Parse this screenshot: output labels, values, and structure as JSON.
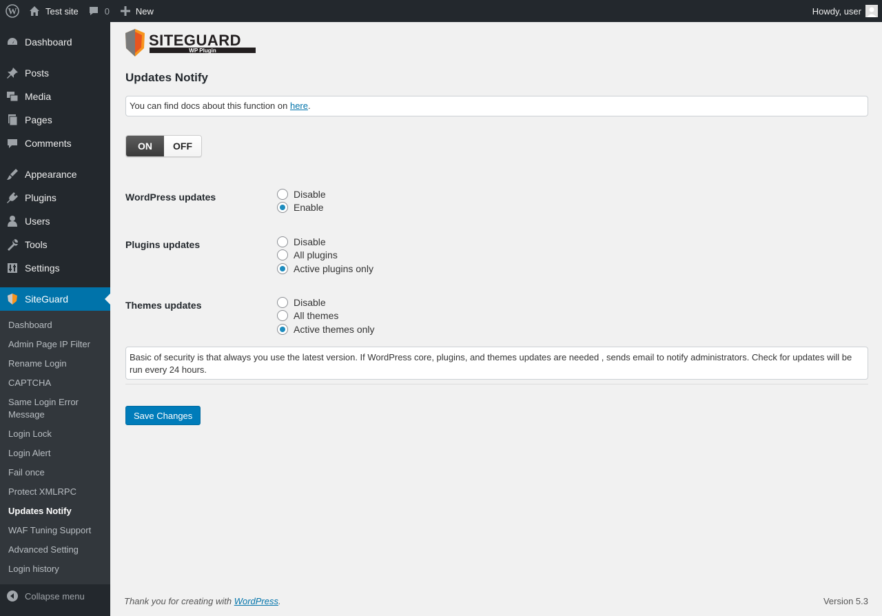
{
  "adminbar": {
    "site_name": "Test site",
    "comment_count": "0",
    "new_label": "New",
    "greeting": "Howdy, user"
  },
  "menu": {
    "items": [
      {
        "label": "Dashboard",
        "icon": "dashboard-icon"
      },
      {
        "label": "Posts",
        "icon": "pin-icon"
      },
      {
        "label": "Media",
        "icon": "media-icon"
      },
      {
        "label": "Pages",
        "icon": "pages-icon"
      },
      {
        "label": "Comments",
        "icon": "comment-icon"
      },
      {
        "label": "Appearance",
        "icon": "brush-icon"
      },
      {
        "label": "Plugins",
        "icon": "plug-icon"
      },
      {
        "label": "Users",
        "icon": "user-icon"
      },
      {
        "label": "Tools",
        "icon": "wrench-icon"
      },
      {
        "label": "Settings",
        "icon": "settings-icon"
      }
    ],
    "current": {
      "label": "SiteGuard",
      "icon": "siteguard-shield-icon"
    },
    "submenu": [
      "Dashboard",
      "Admin Page IP Filter",
      "Rename Login",
      "CAPTCHA",
      "Same Login Error Message",
      "Login Lock",
      "Login Alert",
      "Fail once",
      "Protect XMLRPC",
      "Updates Notify",
      "WAF Tuning Support",
      "Advanced Setting",
      "Login history"
    ],
    "submenu_current_index": 9,
    "collapse_label": "Collapse menu"
  },
  "main": {
    "logo_text": "SITEGUARD",
    "logo_sub": "WP Plugin",
    "title": "Updates Notify",
    "doc_prefix": "You can find docs about this function on ",
    "doc_link": "here",
    "doc_suffix": ".",
    "toggle_on": "ON",
    "toggle_off": "OFF",
    "sections": [
      {
        "label": "WordPress updates",
        "options": [
          "Disable",
          "Enable"
        ],
        "checked": 1
      },
      {
        "label": "Plugins updates",
        "options": [
          "Disable",
          "All plugins",
          "Active plugins only"
        ],
        "checked": 2
      },
      {
        "label": "Themes updates",
        "options": [
          "Disable",
          "All themes",
          "Active themes only"
        ],
        "checked": 2
      }
    ],
    "description": "Basic of security is that always you use the latest version. If WordPress core, plugins, and themes updates are needed , sends email to notify administrators. Check for updates will be run every 24 hours.",
    "save_label": "Save Changes"
  },
  "footer": {
    "thanks_prefix": "Thank you for creating with ",
    "thanks_link": "WordPress",
    "thanks_suffix": ".",
    "version": "Version 5.3"
  },
  "colors": {
    "accent": "#0073aa",
    "sidebar_bg": "#23282d",
    "submenu_bg": "#32373c",
    "background": "#f1f1f1"
  }
}
